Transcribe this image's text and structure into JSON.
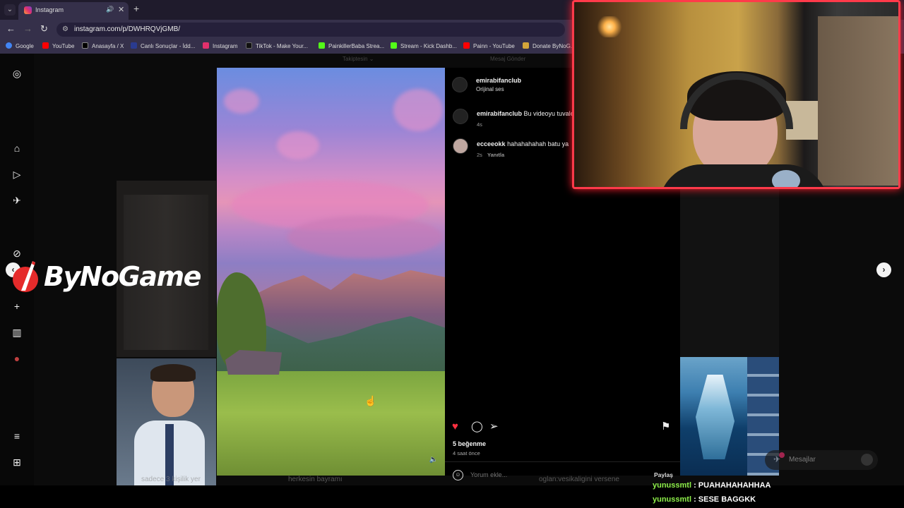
{
  "browser": {
    "tab_title": "Instagram",
    "url": "instagram.com/p/DWHRQVjGMB/",
    "bookmarks": [
      {
        "label": "Google",
        "color": "#4285f4"
      },
      {
        "label": "YouTube",
        "color": "#ff0000"
      },
      {
        "label": "Anasayfa / X",
        "color": "#000000"
      },
      {
        "label": "Canlı Sonuçlar - İdd...",
        "color": "#2a3b8f"
      },
      {
        "label": "Instagram",
        "color": "#e1306c"
      },
      {
        "label": "TikTok - Make Your...",
        "color": "#111111"
      },
      {
        "label": "PainkillerBaba Strea...",
        "color": "#53fc18"
      },
      {
        "label": "Stream - Kick Dashb...",
        "color": "#53fc18"
      },
      {
        "label": "Painn - YouTube",
        "color": "#ff0000"
      },
      {
        "label": "Donate ByNoG...",
        "color": "#d4a53a"
      }
    ]
  },
  "header": {
    "following": "Takiptesin ⌄",
    "send_message": "Mesaj Gönder"
  },
  "post": {
    "author": "emirabifanclub",
    "audio": "Orijinal ses",
    "comments": [
      {
        "user": "emirabifanclub",
        "text": "Bu videoyu tuvale",
        "meta": "4s"
      },
      {
        "user": "ecceeokk",
        "text": "hahahahahah batu ya",
        "meta": "2s",
        "reply": "Yanıtla"
      }
    ],
    "likes": "5 beğenme",
    "time_ago": "4 saat önce",
    "comment_placeholder": "Yorum ekle...",
    "share_label": "Paylaş"
  },
  "messages": {
    "label": "Mesajlar",
    "badge_count": "1"
  },
  "overlay": {
    "logo_text": "ByNoGame",
    "captions": [
      "sadece 3 kişilik yer",
      "herkesin bayramı",
      "oglan:vesikaligini versene"
    ],
    "chat": [
      {
        "user": "yunussmtl",
        "text": "PUAHAHAHAHHAA"
      },
      {
        "user": "yunussmtl",
        "text": "SESE BAGGKK"
      }
    ]
  },
  "colors": {
    "like_red": "#ff3040",
    "webcam_border": "#ff3a4a",
    "chat_user": "#8ef04a"
  }
}
